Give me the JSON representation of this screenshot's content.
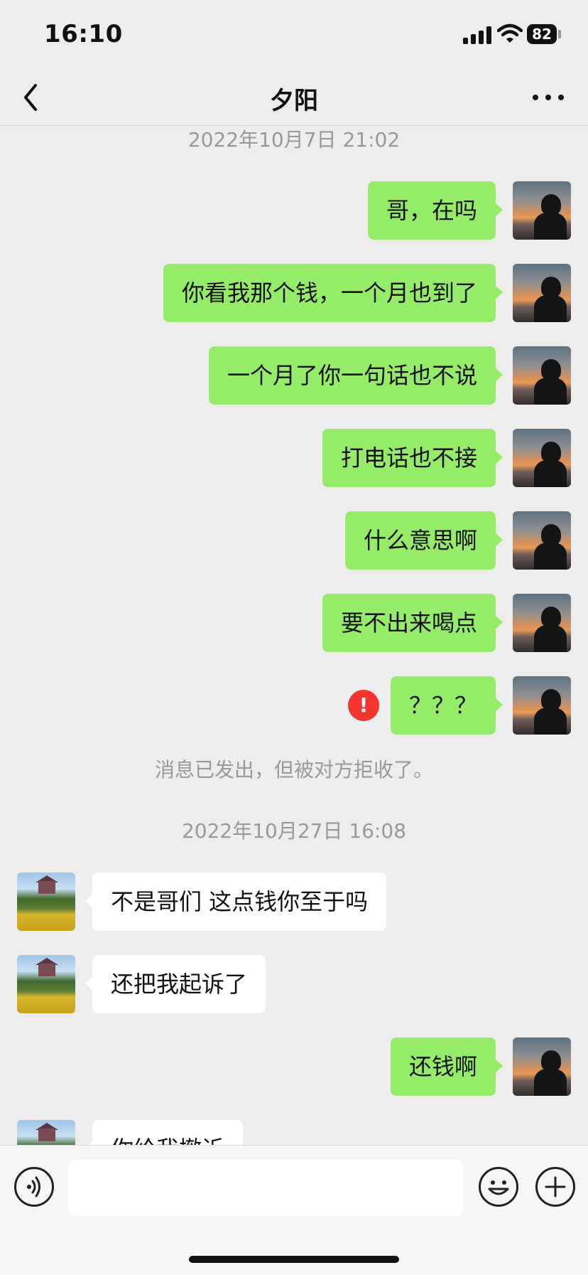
{
  "status_bar": {
    "time": "16:10",
    "battery": "82"
  },
  "nav": {
    "title": "夕阳"
  },
  "chat": {
    "timestamp_1": "2022年10月7日  21:02",
    "timestamp_2": "2022年10月27日  16:08",
    "system_notice": "消息已发出，但被对方拒收了。",
    "messages": [
      {
        "side": "me",
        "text": "哥，在吗"
      },
      {
        "side": "me",
        "text": "你看我那个钱，一个月也到了"
      },
      {
        "side": "me",
        "text": "一个月了你一句话也不说"
      },
      {
        "side": "me",
        "text": "打电话也不接"
      },
      {
        "side": "me",
        "text": "什么意思啊"
      },
      {
        "side": "me",
        "text": "要不出来喝点"
      },
      {
        "side": "me",
        "text": "？？？",
        "error_icon": "!"
      },
      {
        "side": "other",
        "text": "不是哥们 这点钱你至于吗"
      },
      {
        "side": "other",
        "text": "还把我起诉了"
      },
      {
        "side": "me",
        "text": "还钱啊"
      },
      {
        "side": "other",
        "text": "你给我撤诉"
      }
    ]
  },
  "colors": {
    "my_bubble": "#95ec69",
    "other_bubble": "#ffffff",
    "error": "#f43530",
    "background": "#ededed"
  },
  "icons": [
    "back-icon",
    "more-icon",
    "voice-icon",
    "emoji-icon",
    "plus-icon",
    "signal-icon",
    "wifi-icon",
    "battery-icon"
  ]
}
